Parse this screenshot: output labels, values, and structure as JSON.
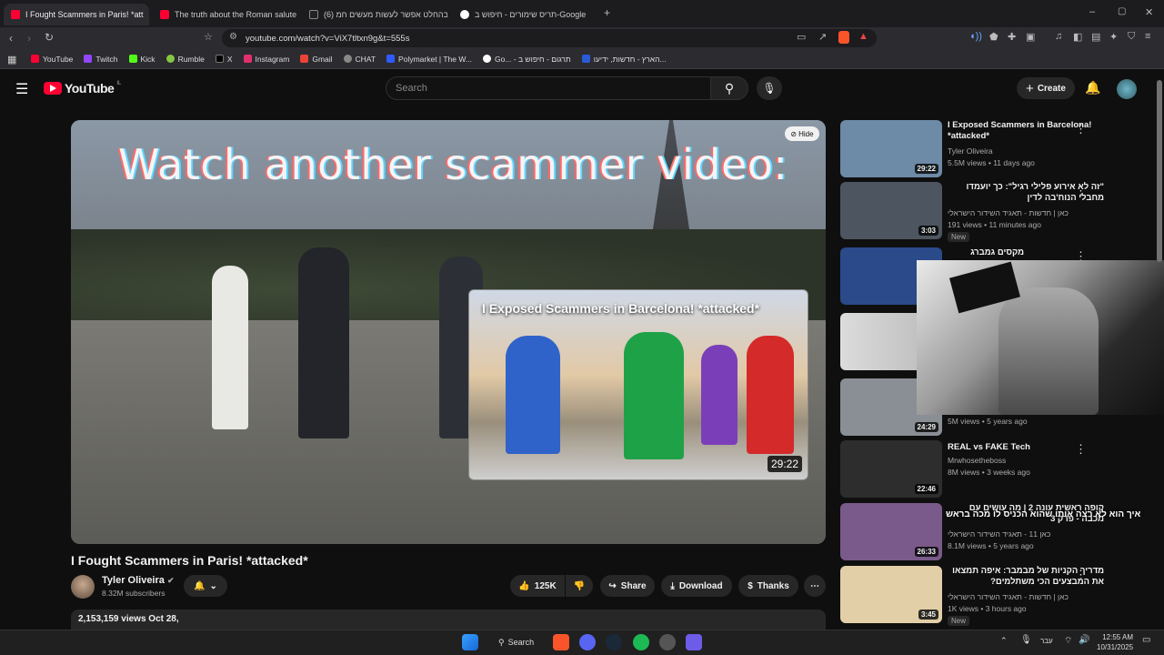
{
  "browser": {
    "tabs": [
      {
        "title": "I Fought Scammers in Paris! *att",
        "active": true
      },
      {
        "title": "The truth about the Roman salute #"
      },
      {
        "title": "(6) בהחלט אפשר לעשות מעשים חמ"
      },
      {
        "title": "תריס שימורים - חיפוש ב-Google"
      }
    ],
    "url": "youtube.com/watch?v=ViX7tltxn9g&t=555s",
    "bookmarks": [
      "YouTube",
      "Twitch",
      "Kick",
      "Rumble",
      "X",
      "Instagram",
      "Gmail",
      "CHAT",
      "Polymarket | The W...",
      "Go... - תרגום - חיפוש ב",
      "הארץ - חדשות, ידיעו..."
    ]
  },
  "youtube": {
    "logo_text": "YouTube",
    "region": "IL",
    "search_placeholder": "Search",
    "create_label": "Create"
  },
  "player": {
    "overlay_text": "Watch another scammer video:",
    "hide_label": "Hide",
    "endcard": {
      "title": "I Exposed Scammers in Barcelona! *attacked*",
      "duration": "29:22"
    }
  },
  "video": {
    "title": "I Fought Scammers in Paris! *attacked*",
    "channel": "Tyler Oliveira",
    "subscribers": "8.32M subscribers",
    "likes": "125K",
    "share_label": "Share",
    "download_label": "Download",
    "thanks_label": "Thanks",
    "views_date": "2,153,159 views  Oct 28,"
  },
  "recommendations": [
    {
      "title": "I Exposed Scammers in Barcelona! *attacked*",
      "channel": "Tyler Oliveira",
      "meta": "5.5M views • 11 days ago",
      "duration": "29:22",
      "thumb": "#6d8aa6"
    },
    {
      "title": "\"זה לא אירוע פלילי רגיל\": כך יועמדו מחבלי הנוח'בה לדין",
      "channel": "כאן | חדשות - תאגיד השידור הישראלי",
      "meta": "191 views • 11 minutes ago",
      "duration": "3:03",
      "badge": "New",
      "thumb": "#4d5560"
    },
    {
      "title": "מקסים גמברג מסביר: כך תסמינים",
      "channel": "",
      "meta": "",
      "duration": "",
      "thumb": "#2a4a8a"
    },
    {
      "title": "",
      "channel": "",
      "meta": "",
      "duration": "",
      "thumb": "#c4c4c4"
    },
    {
      "title": "",
      "channel": "",
      "meta": "5M views • 5 years ago",
      "duration": "24:29",
      "thumb": "#8a8f96"
    },
    {
      "title": "REAL vs FAKE Tech",
      "channel": "Mrwhosetheboss",
      "meta": "8M views • 3 weeks ago",
      "duration": "22:46",
      "thumb": "#2d2d2d"
    },
    {
      "title": "קופה ראשית עונה 2 | מה עושים עם מכבה - פרק 3",
      "channel": "כאן 11 - תאגיד השידור הישראלי",
      "meta": "8.1M views • 5 years ago",
      "duration": "26:33",
      "thumb": "#7a5a8a"
    },
    {
      "title": "מדריך הקניות של מבמבר: איפה תמצאו את המבצעים הכי משתלמים?",
      "channel": "כאן | חדשות - תאגיד השידור הישראלי",
      "meta": "1K views • 3 hours ago",
      "duration": "3:45",
      "badge": "New",
      "thumb": "#e2cfa8"
    }
  ],
  "caption_overlay": "איך הוא לא רצה אותו שהוא הכניס לו מכה בראש",
  "taskbar": {
    "search_label": "Search",
    "lang": "עבר",
    "time": "12:55 AM",
    "date": "10/31/2025"
  }
}
